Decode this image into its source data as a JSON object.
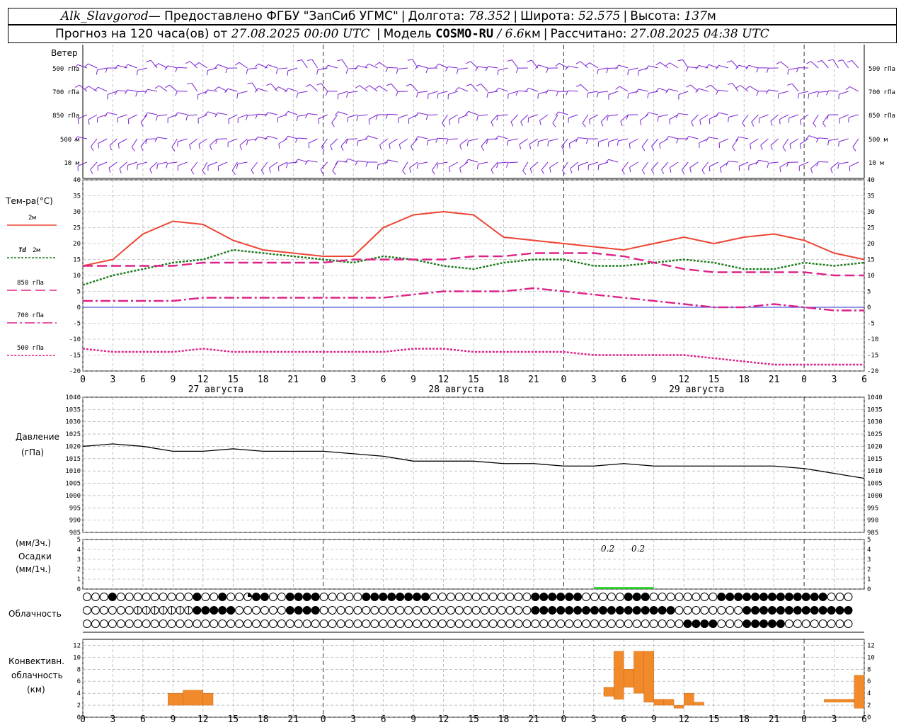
{
  "header": {
    "station": "Alk_Slavgorod",
    "provider": " — Предоставлено ФГБУ \"ЗапСиб УГМС\"",
    "lon_label": "Долгота:",
    "lon_value": "78.352",
    "lat_label": "Широта:",
    "lat_value": "52.575",
    "alt_label": "Высота:",
    "alt_value": "137",
    "alt_unit": "м",
    "forecast_prefix": "Прогноз на 120 часа(ов) от",
    "forecast_time": "27.08.2025 00:00 UTC",
    "model_label": "Модель",
    "model_name": "COSMO-RU",
    "model_res": "/ 6.6",
    "model_res_unit": "км",
    "computed_label": "Рассчитано:",
    "computed_time": "27.08.2025 04:38 UTC"
  },
  "wind_panel": {
    "title": "Ветер",
    "levels": [
      "500 гПа",
      "700 гПа",
      "850 гПа",
      "500 м",
      "10 м"
    ]
  },
  "temp_panel": {
    "title": "Тем-ра(°С)",
    "legend": [
      {
        "label": "2м",
        "color": "#ee4433"
      },
      {
        "label_it": "Td",
        "label": " 2м",
        "color": "#1a7a1a"
      },
      {
        "label": "850 гПа",
        "color": "#dd2288"
      },
      {
        "label": "700 гПа",
        "color": "#dd2288"
      },
      {
        "label": "500 гПа",
        "color": "#dd2288"
      }
    ]
  },
  "x_axis": {
    "hour_labels": [
      "0",
      "3",
      "6",
      "9",
      "12",
      "15",
      "18",
      "21",
      "0",
      "3",
      "6",
      "9",
      "12",
      "15",
      "18",
      "21",
      "0",
      "3",
      "6",
      "9",
      "12",
      "15",
      "18",
      "21",
      "0",
      "3",
      "6"
    ],
    "day_labels": [
      "27 августа",
      "28 августа",
      "29 августа"
    ]
  },
  "pressure_panel": {
    "title": "Давление",
    "unit": "(гПа)"
  },
  "precip_panel": {
    "unit3": "(мм/3ч.)",
    "title": "Осадки",
    "unit1": "(мм/1ч.)",
    "annotations": [
      "0.2",
      "0.2"
    ]
  },
  "cloud_panel": {
    "title": "Облачность"
  },
  "conv_panel": {
    "title1": "Конвективн.",
    "title2": "облачность",
    "unit": "(км)"
  },
  "chart_data": [
    {
      "type": "line",
      "title": "Тем-ра(°С)",
      "x_hours": [
        0,
        3,
        6,
        9,
        12,
        15,
        18,
        21,
        24,
        27,
        30,
        33,
        36,
        39,
        42,
        45,
        48,
        51,
        54,
        57,
        60,
        63,
        66,
        69,
        72,
        75,
        78
      ],
      "ylim": [
        -20,
        40
      ],
      "y_ticks": [
        40,
        35,
        30,
        25,
        20,
        15,
        10,
        5,
        0,
        -5,
        -10,
        -15,
        -20
      ],
      "grid": true,
      "series": [
        {
          "name": "2м",
          "color": "#ee4433",
          "values": [
            13,
            15,
            23,
            27,
            26,
            21,
            18,
            17,
            16,
            16,
            25,
            29,
            30,
            29,
            22,
            21,
            20,
            19,
            18,
            20,
            22,
            20,
            22,
            23,
            21,
            17,
            15
          ]
        },
        {
          "name": "Td 2м",
          "color": "#1a7a1a",
          "values": [
            7,
            10,
            12,
            14,
            15,
            18,
            17,
            16,
            15,
            14,
            16,
            15,
            13,
            12,
            14,
            15,
            15,
            13,
            13,
            14,
            15,
            14,
            12,
            12,
            14,
            13,
            14
          ]
        },
        {
          "name": "850 гПа",
          "color": "#dd2288",
          "values": [
            13,
            13,
            13,
            13,
            14,
            14,
            14,
            14,
            14,
            15,
            15,
            15,
            15,
            16,
            16,
            17,
            17,
            17,
            16,
            14,
            12,
            11,
            11,
            11,
            11,
            10,
            10
          ]
        },
        {
          "name": "700 гПа",
          "color": "#dd2288",
          "values": [
            2,
            2,
            2,
            2,
            3,
            3,
            3,
            3,
            3,
            3,
            3,
            4,
            5,
            5,
            5,
            6,
            5,
            4,
            3,
            2,
            1,
            0,
            0,
            1,
            0,
            -1,
            -1
          ]
        },
        {
          "name": "500 гПа",
          "color": "#dd2288",
          "values": [
            -13,
            -14,
            -14,
            -14,
            -13,
            -14,
            -14,
            -14,
            -14,
            -14,
            -14,
            -13,
            -13,
            -14,
            -14,
            -14,
            -14,
            -15,
            -15,
            -15,
            -15,
            -16,
            -17,
            -18,
            -18,
            -18,
            -18
          ]
        }
      ]
    },
    {
      "type": "line",
      "title": "Давление",
      "x_hours": [
        0,
        3,
        6,
        9,
        12,
        15,
        18,
        21,
        24,
        27,
        30,
        33,
        36,
        39,
        42,
        45,
        48,
        51,
        54,
        57,
        60,
        63,
        66,
        69,
        72,
        75,
        78
      ],
      "ylim": [
        985,
        1040
      ],
      "y_ticks": [
        1040,
        1035,
        1030,
        1025,
        1020,
        1015,
        1010,
        1005,
        1000,
        995,
        990,
        985
      ],
      "series": [
        {
          "name": "Давление",
          "color": "#000000",
          "values": [
            1020,
            1021,
            1020,
            1018,
            1018,
            1019,
            1018,
            1018,
            1018,
            1017,
            1016,
            1014,
            1014,
            1014,
            1013,
            1013,
            1012,
            1012,
            1013,
            1012,
            1012,
            1012,
            1012,
            1012,
            1011,
            1009,
            1007
          ]
        }
      ]
    },
    {
      "type": "bar",
      "title": "Осадки",
      "x_hours": [
        51,
        54
      ],
      "ylim": [
        0,
        5
      ],
      "y_ticks": [
        5,
        4,
        3,
        2,
        1,
        0
      ],
      "values": [
        0.2,
        0.2
      ]
    },
    {
      "type": "bar",
      "title": "Конвективн. облачность",
      "ylim": [
        0,
        13
      ],
      "y_ticks": [
        12,
        10,
        8,
        6,
        4,
        2,
        0
      ],
      "bars": [
        {
          "x0": 8.5,
          "x1": 10,
          "bottom": 2,
          "top": 4
        },
        {
          "x0": 10,
          "x1": 12,
          "bottom": 2,
          "top": 4.5
        },
        {
          "x0": 12,
          "x1": 13,
          "bottom": 2,
          "top": 4
        },
        {
          "x0": 52,
          "x1": 53,
          "bottom": 3.5,
          "top": 5
        },
        {
          "x0": 53,
          "x1": 54,
          "bottom": 3,
          "top": 11
        },
        {
          "x0": 54,
          "x1": 55,
          "bottom": 5,
          "top": 8
        },
        {
          "x0": 55,
          "x1": 56,
          "bottom": 4,
          "top": 11
        },
        {
          "x0": 56,
          "x1": 57,
          "bottom": 2.5,
          "top": 11
        },
        {
          "x0": 57,
          "x1": 58,
          "bottom": 2,
          "top": 3
        },
        {
          "x0": 58,
          "x1": 59,
          "bottom": 2,
          "top": 3
        },
        {
          "x0": 59,
          "x1": 60,
          "bottom": 1.5,
          "top": 2
        },
        {
          "x0": 60,
          "x1": 61,
          "bottom": 2,
          "top": 4
        },
        {
          "x0": 61,
          "x1": 62,
          "bottom": 2,
          "top": 2.5
        },
        {
          "x0": 74,
          "x1": 77,
          "bottom": 2.5,
          "top": 3
        },
        {
          "x0": 77,
          "x1": 78,
          "bottom": 1.5,
          "top": 7
        }
      ]
    },
    {
      "type": "table",
      "title": "Облачность",
      "rows": [
        "0003000000000300300233003333000003333333300000000000033333300000333000000003333333333333000",
        "0000001111111333330000003333000000000000000000000000033333333333333333000000003333333333333",
        "0000000000000000000000000000000000000000000000000000000000000000000000033330003333300000000"
      ]
    }
  ],
  "colors": {
    "wind": "#7b22d4",
    "grid": "#999999",
    "zero_line": "#2233cc",
    "precip": "#22cc22",
    "convective": "#f08a2a"
  }
}
